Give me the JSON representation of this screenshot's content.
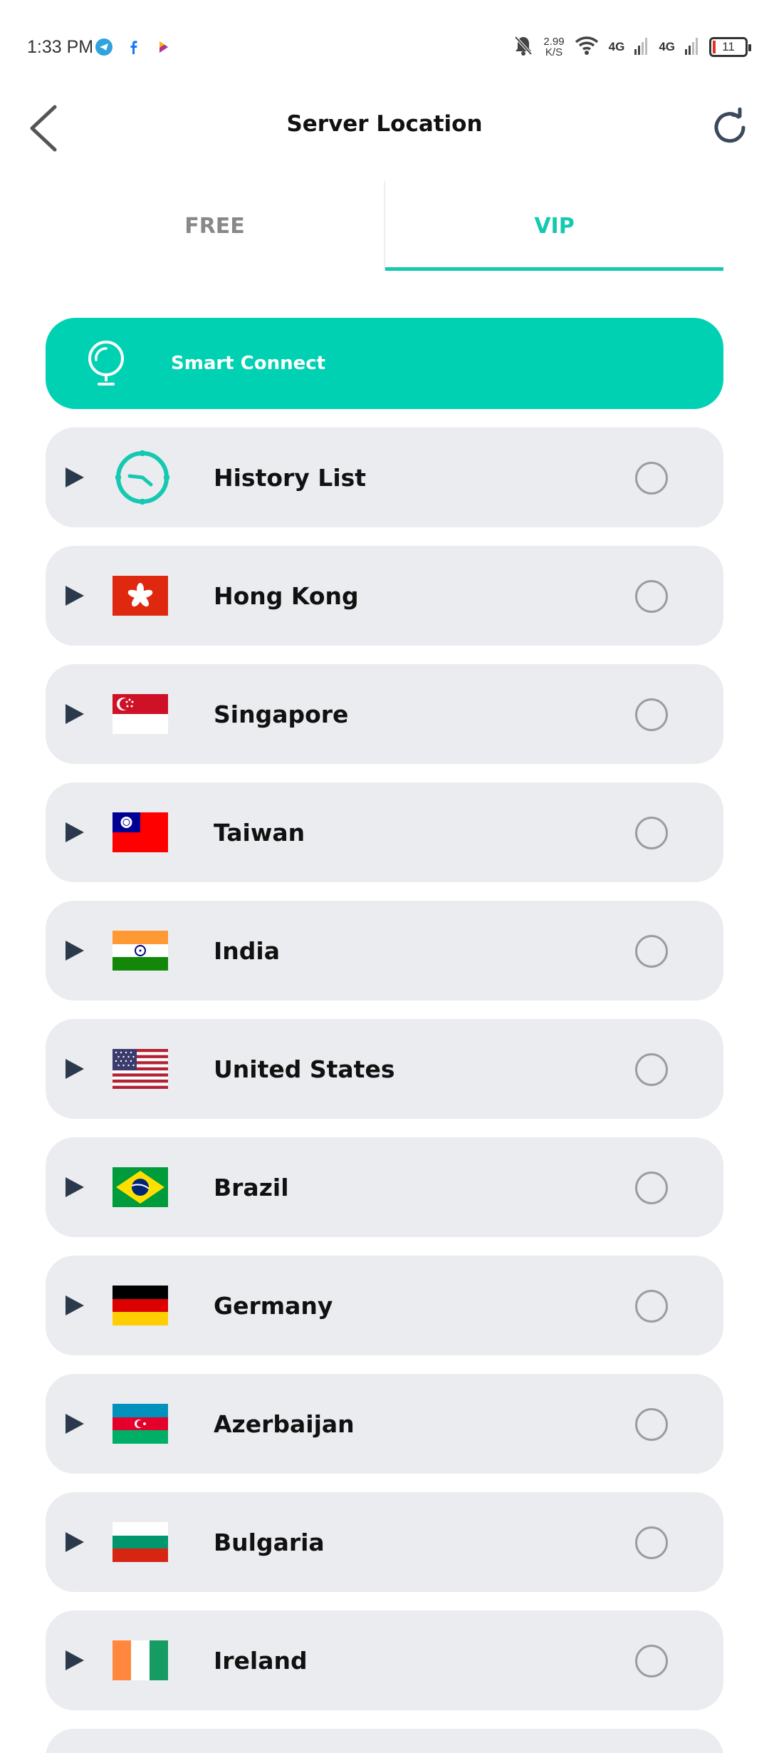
{
  "status_bar": {
    "time": "1:33 PM",
    "speed_value": "2.99",
    "speed_unit": "K/S",
    "net1": "4G",
    "net2": "4G",
    "battery": "11",
    "app_icons": [
      "telegram-icon",
      "facebook-icon",
      "app-icon"
    ]
  },
  "header": {
    "title": "Server Location"
  },
  "tabs": [
    {
      "label": "FREE",
      "active": false
    },
    {
      "label": "VIP",
      "active": true
    }
  ],
  "smart_connect": {
    "label": "Smart Connect"
  },
  "servers": [
    {
      "label": "History List",
      "icon": "clock-icon"
    },
    {
      "label": "Hong Kong",
      "icon": "hong-kong-flag-icon"
    },
    {
      "label": "Singapore",
      "icon": "singapore-flag-icon"
    },
    {
      "label": "Taiwan",
      "icon": "taiwan-flag-icon"
    },
    {
      "label": "India",
      "icon": "india-flag-icon"
    },
    {
      "label": "United States",
      "icon": "united-states-flag-icon"
    },
    {
      "label": "Brazil",
      "icon": "brazil-flag-icon"
    },
    {
      "label": "Germany",
      "icon": "germany-flag-icon"
    },
    {
      "label": "Azerbaijan",
      "icon": "azerbaijan-flag-icon"
    },
    {
      "label": "Bulgaria",
      "icon": "bulgaria-flag-icon"
    },
    {
      "label": "Ireland",
      "icon": "ireland-flag-icon"
    }
  ],
  "colors": {
    "accent": "#00d1b2",
    "row_bg": "#ebecf0",
    "play": "#2a3a4c"
  }
}
